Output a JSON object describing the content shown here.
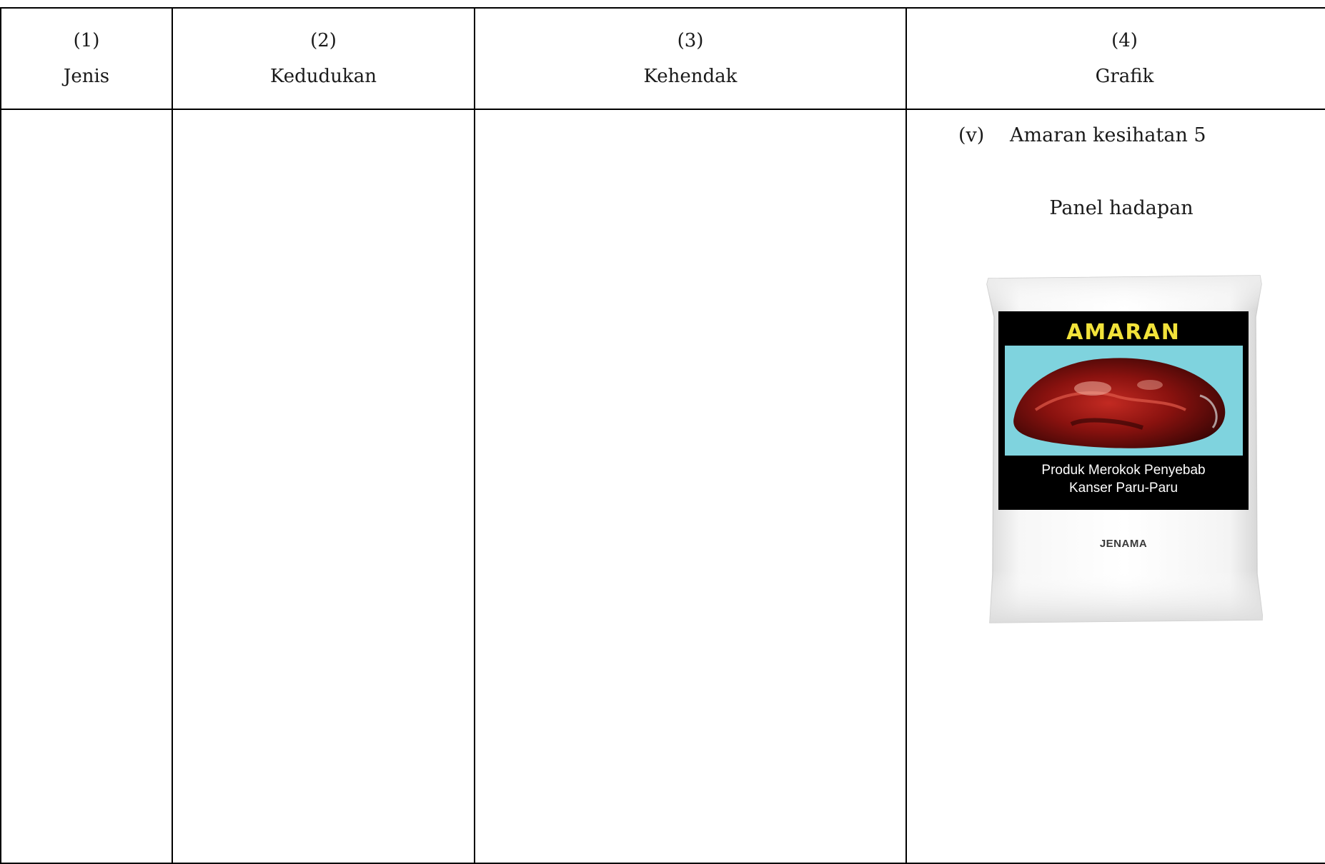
{
  "header": {
    "col1": {
      "number": "(1)",
      "label": "Jenis"
    },
    "col2": {
      "number": "(2)",
      "label": "Kedudukan"
    },
    "col3": {
      "number": "(3)",
      "label": "Kehendak"
    },
    "col4": {
      "number": "(4)",
      "label": "Grafik"
    }
  },
  "grafik": {
    "item_number": "(v)",
    "item_label": "Amaran kesihatan 5",
    "panel_title": "Panel hadapan",
    "pack": {
      "warning_heading": "AMARAN",
      "warning_line1": "Produk Merokok Penyebab",
      "warning_line2": "Kanser Paru-Paru",
      "brand": "JENAMA"
    }
  },
  "colors": {
    "warning_heading": "#f2e23a",
    "warning_band": "#000000",
    "photo_background": "#7fd3de",
    "pack_body": "#f4f4f4"
  }
}
